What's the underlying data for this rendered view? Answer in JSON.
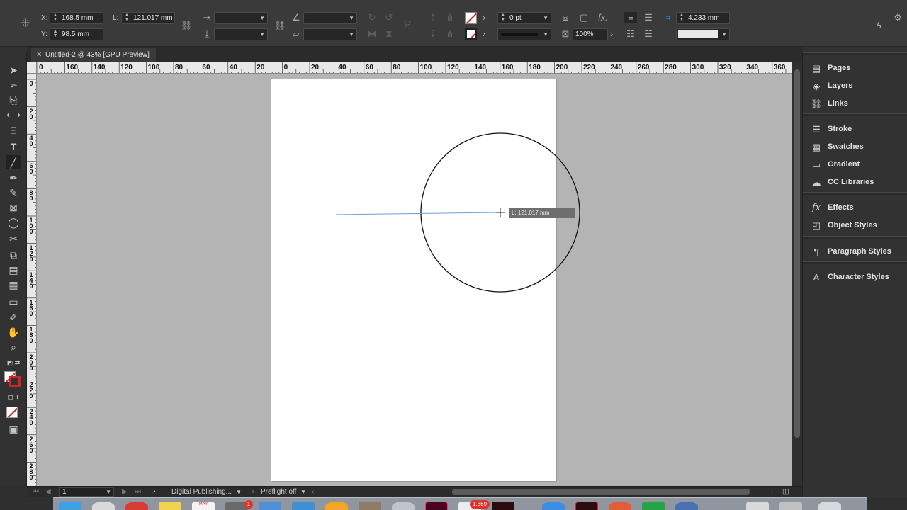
{
  "control_bar": {
    "x_label": "X:",
    "x_value": "168.5 mm",
    "y_label": "Y:",
    "y_value": "98.5 mm",
    "l_label": "L:",
    "l_value": "121.017 mm",
    "stroke_weight": "0 pt",
    "opacity": "100%",
    "grid_value": "4.233 mm",
    "fx_label": "fx."
  },
  "document_tab": {
    "title": "Untitled-2 @ 43% [GPU Preview]"
  },
  "rulers": {
    "horizontal": [
      "0",
      "160",
      "140",
      "120",
      "100",
      "80",
      "60",
      "40",
      "20",
      "0",
      "20",
      "40",
      "60",
      "80",
      "100",
      "120",
      "140",
      "160",
      "180",
      "200",
      "220",
      "240",
      "260",
      "280",
      "300",
      "320",
      "340",
      "360",
      "3"
    ],
    "vertical": [
      "0",
      "20",
      "40",
      "60",
      "80",
      "100",
      "120",
      "140",
      "160",
      "180",
      "200",
      "220",
      "240",
      "260",
      "280"
    ]
  },
  "canvas": {
    "measure_tooltip": "L: 121.017 mm"
  },
  "status_bar": {
    "page_number": "1",
    "workspace": "Digital Publishing...",
    "preflight": "Preflight off"
  },
  "panels": {
    "groups": [
      [
        {
          "icon": "pages-icon",
          "label": "Pages"
        },
        {
          "icon": "layers-icon",
          "label": "Layers"
        },
        {
          "icon": "links-icon",
          "label": "Links"
        }
      ],
      [
        {
          "icon": "stroke-icon",
          "label": "Stroke"
        },
        {
          "icon": "swatches-icon",
          "label": "Swatches"
        },
        {
          "icon": "gradient-icon",
          "label": "Gradient"
        },
        {
          "icon": "cc-libraries-icon",
          "label": "CC Libraries"
        }
      ],
      [
        {
          "icon": "effects-icon",
          "label": "Effects"
        },
        {
          "icon": "object-styles-icon",
          "label": "Object Styles"
        }
      ],
      [
        {
          "icon": "paragraph-styles-icon",
          "label": "Paragraph Styles"
        }
      ],
      [
        {
          "icon": "character-styles-icon",
          "label": "Character Styles"
        }
      ]
    ]
  },
  "dock": {
    "badge_count": "1,369",
    "badge_small": "1",
    "calendar_month": "MAY"
  },
  "colors": {
    "accent": "#2d8ceb",
    "none_slash": "#d42323",
    "selection_line": "#6f9fd6"
  }
}
